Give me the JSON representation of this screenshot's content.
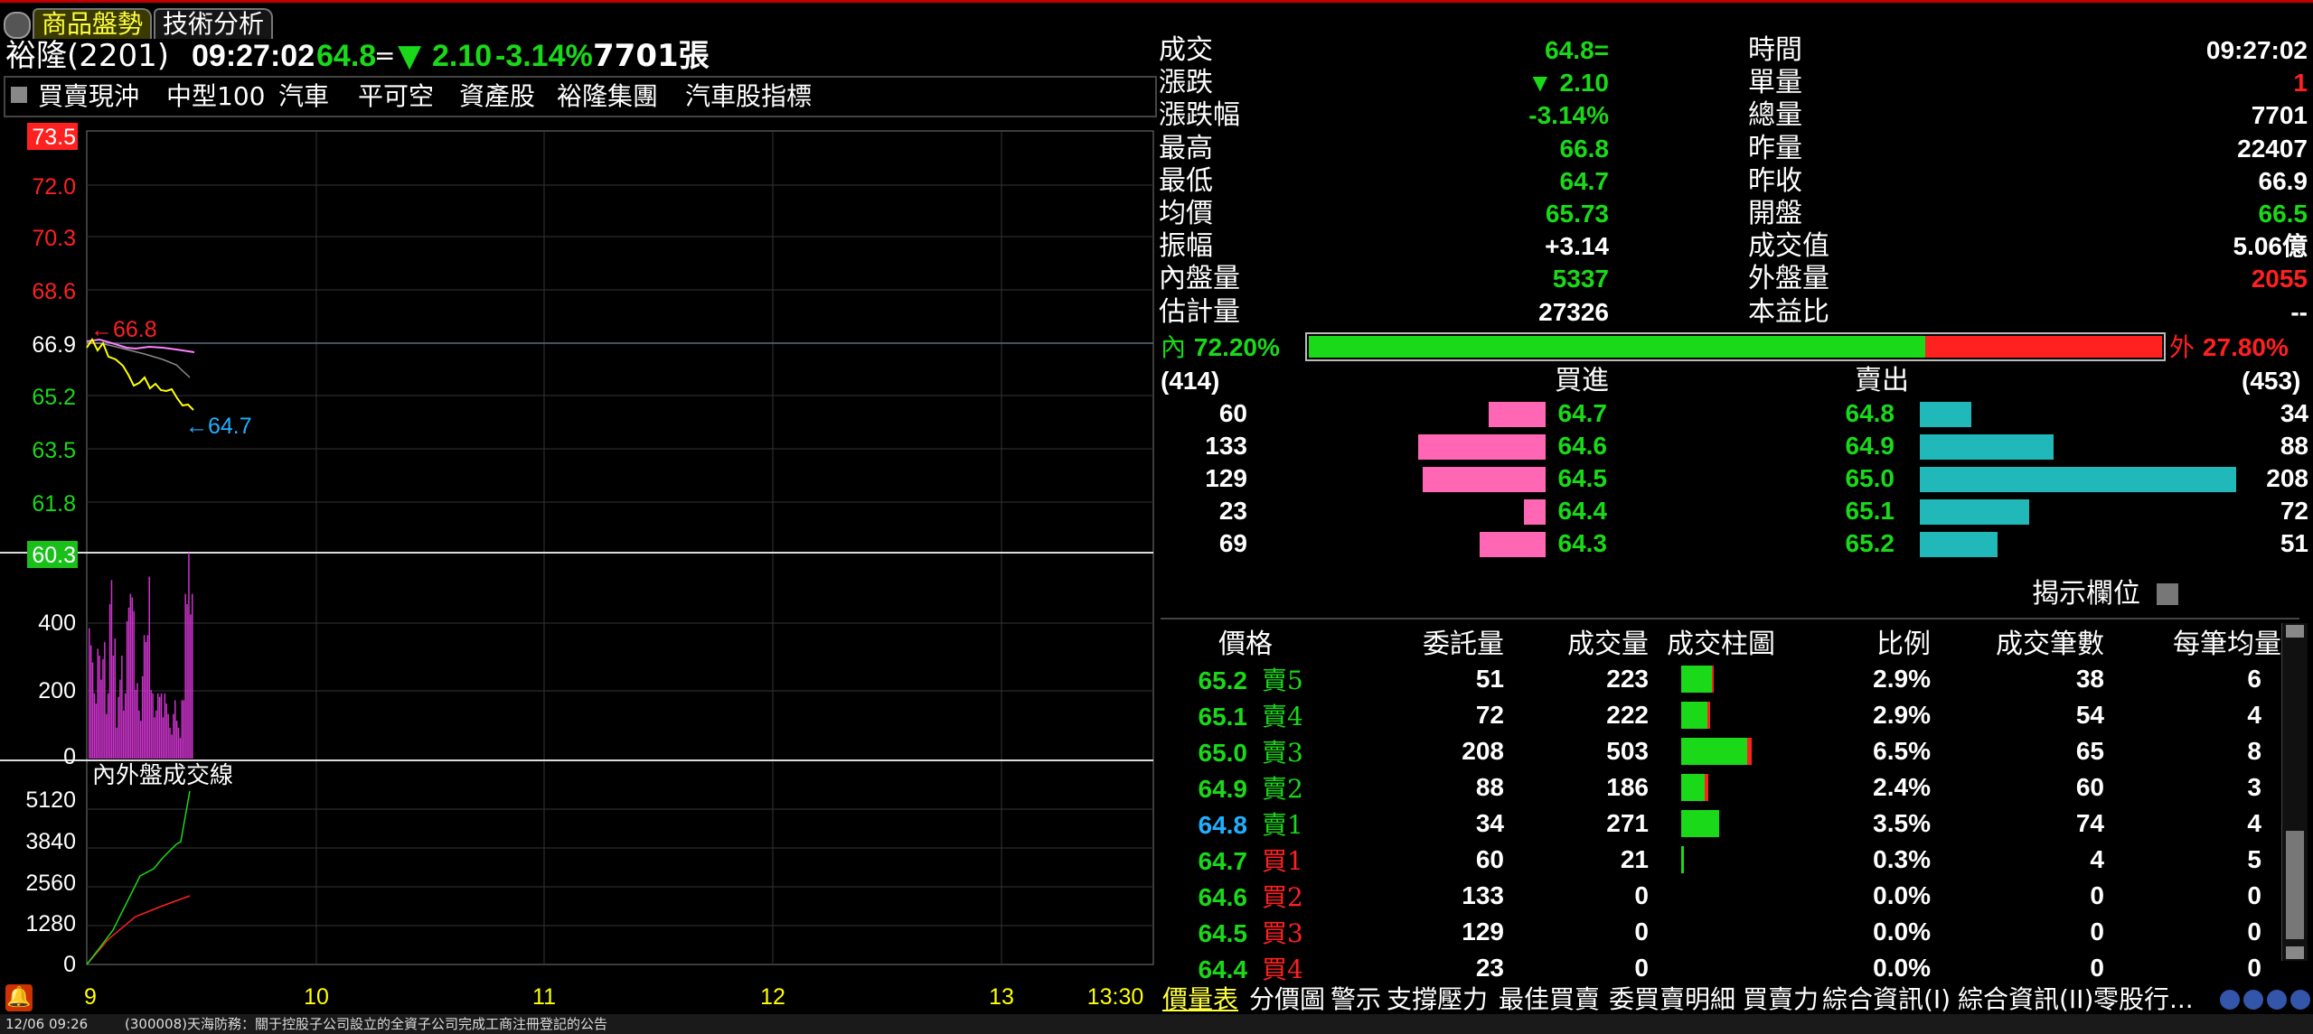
{
  "tabs": {
    "quote": "商品盤勢",
    "tech": "技術分析"
  },
  "header": {
    "name": "裕隆(2201)",
    "time": "09:27:02",
    "price": "64.8",
    "eq": "=",
    "down_icon": "▼",
    "change": "2.10",
    "change_pct": "-3.14%",
    "volume": "7701張"
  },
  "categories": [
    "買賣現沖",
    "中型100",
    "汽車",
    "平可空",
    "資產股",
    "裕隆集團",
    "汽車股指標"
  ],
  "chart": {
    "price_labels": [
      "73.5",
      "72.0",
      "70.3",
      "68.6",
      "66.9",
      "65.2",
      "63.5",
      "61.8",
      "60.3"
    ],
    "price_label_colors": [
      "red-box",
      "red",
      "red",
      "red",
      "white",
      "green",
      "green",
      "green",
      "green-box"
    ],
    "high_marker": "←66.8",
    "low_marker": "←64.7",
    "vol_labels": [
      "400",
      "200",
      "0"
    ],
    "vol_values": [
      380,
      330,
      280,
      190,
      160,
      320,
      300,
      230,
      290,
      340,
      130,
      190,
      450,
      520,
      300,
      350,
      90,
      180,
      230,
      300,
      140,
      190,
      400,
      440,
      480,
      470,
      430,
      200,
      220,
      140,
      110,
      240,
      360,
      340,
      360,
      530,
      200,
      190,
      120,
      140,
      190,
      180,
      190,
      120,
      190,
      160,
      130,
      90,
      70,
      130,
      170,
      110,
      90,
      60,
      170,
      170,
      480,
      450,
      600,
      420,
      480
    ],
    "io_title": "內外盤成交線",
    "io_labels": [
      "5120",
      "3840",
      "2560",
      "1280",
      "0"
    ],
    "time_labels": [
      "9",
      "10",
      "11",
      "12",
      "13",
      "13:30"
    ]
  },
  "info": {
    "left": [
      {
        "label": "成交",
        "value": "64.8=",
        "color": "g"
      },
      {
        "label": "漲跌",
        "value": "▼ 2.10",
        "color": "g"
      },
      {
        "label": "漲跌幅",
        "value": "-3.14%",
        "color": "g"
      },
      {
        "label": "最高",
        "value": "66.8",
        "color": "g"
      },
      {
        "label": "最低",
        "value": "64.7",
        "color": "g"
      },
      {
        "label": "均價",
        "value": "65.73",
        "color": "g"
      },
      {
        "label": "振幅",
        "value": "+3.14",
        "color": "w"
      },
      {
        "label": "內盤量",
        "value": "5337",
        "color": "g"
      },
      {
        "label": "估計量",
        "value": "27326",
        "color": "w"
      }
    ],
    "right": [
      {
        "label": "時間",
        "value": "09:27:02",
        "color": "w"
      },
      {
        "label": "單量",
        "value": "1",
        "color": "r"
      },
      {
        "label": "總量",
        "value": "7701",
        "color": "w"
      },
      {
        "label": "昨量",
        "value": "22407",
        "color": "w"
      },
      {
        "label": "昨收",
        "value": "66.9",
        "color": "w"
      },
      {
        "label": "開盤",
        "value": "66.5",
        "color": "g"
      },
      {
        "label": "成交值",
        "value": "5.06億",
        "color": "w"
      },
      {
        "label": "外盤量",
        "value": "2055",
        "color": "r"
      },
      {
        "label": "本益比",
        "value": "--",
        "color": "w"
      }
    ]
  },
  "ratio": {
    "inner_label": "內",
    "inner_pct": "72.20%",
    "outer_label": "外",
    "outer_pct": "27.80%",
    "inner_fraction": 0.722
  },
  "book": {
    "bid_total": "(414)",
    "ask_total": "(453)",
    "bid_title": "買進",
    "ask_title": "賣出",
    "bids": [
      {
        "qty": "60",
        "price": "64.7"
      },
      {
        "qty": "133",
        "price": "64.6"
      },
      {
        "qty": "129",
        "price": "64.5"
      },
      {
        "qty": "23",
        "price": "64.4"
      },
      {
        "qty": "69",
        "price": "64.3"
      }
    ],
    "asks": [
      {
        "price": "64.8",
        "qty": "34"
      },
      {
        "price": "64.9",
        "qty": "88"
      },
      {
        "price": "65.0",
        "qty": "208"
      },
      {
        "price": "65.1",
        "qty": "72"
      },
      {
        "price": "65.2",
        "qty": "51"
      }
    ],
    "max_qty": 208
  },
  "reveal": {
    "label": "揭示欄位"
  },
  "table": {
    "headers": [
      "價格",
      "委託量",
      "成交量",
      "成交柱圖",
      "比例",
      "成交筆數",
      "每筆均量"
    ],
    "rows": [
      {
        "price": "65.2",
        "pc": "g",
        "side": "賣5",
        "sc": "g",
        "order": "51",
        "vol": "223",
        "bar": 0.45,
        "red": 0.05,
        "ratio": "2.9%",
        "count": "38",
        "avg": "6"
      },
      {
        "price": "65.1",
        "pc": "g",
        "side": "賣4",
        "sc": "g",
        "order": "72",
        "vol": "222",
        "bar": 0.4,
        "red": 0.1,
        "ratio": "2.9%",
        "count": "54",
        "avg": "4"
      },
      {
        "price": "65.0",
        "pc": "g",
        "side": "賣3",
        "sc": "g",
        "order": "208",
        "vol": "503",
        "bar": 0.98,
        "red": 0.06,
        "ratio": "6.5%",
        "count": "65",
        "avg": "8"
      },
      {
        "price": "64.9",
        "pc": "g",
        "side": "賣2",
        "sc": "g",
        "order": "88",
        "vol": "186",
        "bar": 0.38,
        "red": 0.12,
        "ratio": "2.4%",
        "count": "60",
        "avg": "3"
      },
      {
        "price": "64.8",
        "pc": "c",
        "side": "賣1",
        "sc": "g",
        "order": "34",
        "vol": "271",
        "bar": 0.53,
        "red": 0,
        "ratio": "3.5%",
        "count": "74",
        "avg": "4"
      },
      {
        "price": "64.7",
        "pc": "g",
        "side": "買1",
        "sc": "r",
        "order": "60",
        "vol": "21",
        "bar": 0.04,
        "red": 0,
        "ratio": "0.3%",
        "count": "4",
        "avg": "5"
      },
      {
        "price": "64.6",
        "pc": "g",
        "side": "買2",
        "sc": "r",
        "order": "133",
        "vol": "0",
        "bar": 0,
        "red": 0,
        "ratio": "0.0%",
        "count": "0",
        "avg": "0"
      },
      {
        "price": "64.5",
        "pc": "g",
        "side": "買3",
        "sc": "r",
        "order": "129",
        "vol": "0",
        "bar": 0,
        "red": 0,
        "ratio": "0.0%",
        "count": "0",
        "avg": "0"
      },
      {
        "price": "64.4",
        "pc": "g",
        "side": "買4",
        "sc": "r",
        "order": "23",
        "vol": "0",
        "bar": 0,
        "red": 0,
        "ratio": "0.0%",
        "count": "0",
        "avg": "0"
      }
    ]
  },
  "bottom_tabs": [
    "價量表",
    "分價圖",
    "警示",
    "支撐壓力",
    "最佳買賣",
    "委買賣明細",
    "買賣力",
    "綜合資訊(I)",
    "綜合資訊(II)",
    "零股行..."
  ],
  "status": {
    "datetime": "12/06 09:26",
    "news": "(300008)天海防務：關于控股子公司設立的全資子公司完成工商注冊登記的公告"
  }
}
